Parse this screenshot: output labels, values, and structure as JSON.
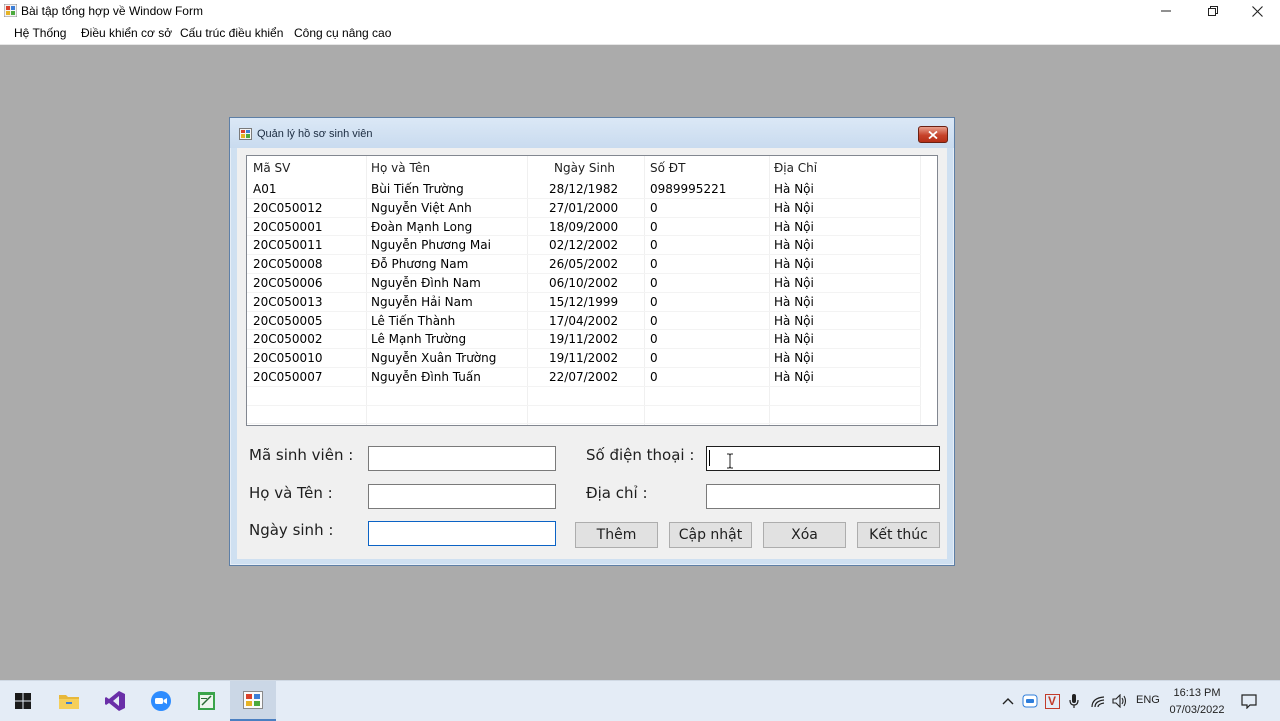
{
  "window": {
    "title": "Bài tập tổng hợp về Window Form",
    "controls": {
      "minimize": "—",
      "restore": "❐",
      "close": "✕"
    }
  },
  "menu": {
    "items": [
      {
        "label": "Hệ Thống"
      },
      {
        "label": "Điều khiển cơ sở"
      },
      {
        "label": "Cấu trúc điều khiển"
      },
      {
        "label": "Công cụ nâng cao"
      }
    ]
  },
  "dialog": {
    "title": "Quản lý hồ sơ sinh viên",
    "close_glyph": "✕",
    "list": {
      "columns": [
        "Mã SV",
        "Họ và Tên",
        "Ngày Sinh",
        "Số ĐT",
        "Địa Chỉ"
      ],
      "rows": [
        [
          "A01",
          "Bùi Tiến Trường",
          "28/12/1982",
          "0989995221",
          "Hà Nội"
        ],
        [
          "20C050012",
          "Nguyễn Việt Anh",
          "27/01/2000",
          "0",
          "Hà Nội"
        ],
        [
          "20C050001",
          "Đoàn Mạnh Long",
          "18/09/2000",
          "0",
          "Hà Nội"
        ],
        [
          "20C050011",
          "Nguyễn Phương Mai",
          "02/12/2002",
          "0",
          "Hà Nội"
        ],
        [
          "20C050008",
          "Đỗ Phương Nam",
          "26/05/2002",
          "0",
          "Hà Nội"
        ],
        [
          "20C050006",
          "Nguyễn Đình Nam",
          "06/10/2002",
          "0",
          "Hà Nội"
        ],
        [
          "20C050013",
          "Nguyễn Hải Nam",
          "15/12/1999",
          "0",
          "Hà Nội"
        ],
        [
          "20C050005",
          "Lê Tiến Thành",
          "17/04/2002",
          "0",
          "Hà Nội"
        ],
        [
          "20C050002",
          "Lê Mạnh Trường",
          "19/11/2002",
          "0",
          "Hà Nội"
        ],
        [
          "20C050010",
          "Nguyễn Xuân Trường",
          "19/11/2002",
          "0",
          "Hà Nội"
        ],
        [
          "20C050007",
          "Nguyễn Đình Tuấn",
          "22/07/2002",
          "0",
          "Hà Nội"
        ]
      ]
    },
    "form": {
      "ma_sv_label": "Mã sinh viên :",
      "ma_sv_value": "",
      "ho_ten_label": "Họ và Tên :",
      "ho_ten_value": "",
      "ngay_sinh_label": "Ngày sinh :",
      "ngay_sinh_value": "",
      "so_dt_label": "Số điện thoại :",
      "so_dt_value": "",
      "dia_chi_label": "Địa chỉ :",
      "dia_chi_value": ""
    },
    "buttons": {
      "add": "Thêm",
      "update": "Cập nhật",
      "delete": "Xóa",
      "exit": "Kết thúc"
    }
  },
  "taskbar": {
    "language": "ENG",
    "time": "16:13 PM",
    "date": "07/03/2022",
    "tray_v_label": "V",
    "colors": {
      "accent": "#4a7fc1"
    }
  }
}
